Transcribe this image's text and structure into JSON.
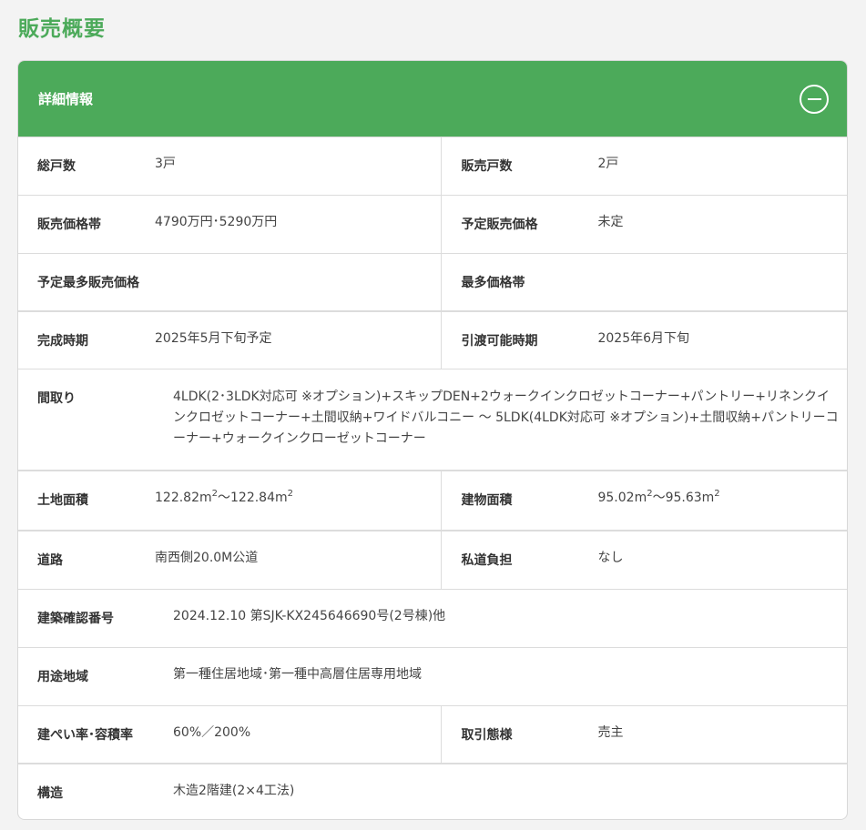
{
  "page_title": "販売概要",
  "section": {
    "title": "詳細情報",
    "collapse_icon": "minus-circle-icon"
  },
  "rows": {
    "total_units": {
      "label": "総戸数",
      "value": "3戸"
    },
    "units_for_sale": {
      "label": "販売戸数",
      "value": "2戸"
    },
    "price_range": {
      "label": "販売価格帯",
      "value": "4790万円･5290万円"
    },
    "planned_price": {
      "label": "予定販売価格",
      "value": "未定"
    },
    "planned_most_common_price": {
      "label": "予定最多販売価格",
      "value": ""
    },
    "most_common_price_band": {
      "label": "最多価格帯",
      "value": ""
    },
    "completion": {
      "label": "完成時期",
      "value": "2025年5月下旬予定"
    },
    "handover": {
      "label": "引渡可能時期",
      "value": "2025年6月下旬"
    },
    "layout": {
      "label": "間取り",
      "value": "4LDK(2･3LDK対応可 ※オプション)+スキップDEN+2ウォークインクロゼットコーナー+パントリー+リネンクインクロゼットコーナー+土間収納+ワイドバルコニー 〜 5LDK(4LDK対応可 ※オプション)+土間収納+パントリーコーナー+ウォークインクローゼットコーナー"
    },
    "land_area": {
      "label": "土地面積",
      "min": "122.82m",
      "sep": "〜",
      "max": "122.84m",
      "unit_exp": "2"
    },
    "building_area": {
      "label": "建物面積",
      "min": "95.02m",
      "sep": "〜",
      "max": "95.63m",
      "unit_exp": "2"
    },
    "road": {
      "label": "道路",
      "value": "南西側20.0M公道"
    },
    "private_road_burden": {
      "label": "私道負担",
      "value": "なし"
    },
    "building_confirmation": {
      "label": "建築確認番号",
      "value": "2024.12.10 第SJK-KX245646690号(2号棟)他"
    },
    "zoning": {
      "label": "用途地域",
      "value": "第一種住居地域･第一種中高層住居専用地域"
    },
    "coverage_ratio": {
      "label": "建ぺい率･容積率",
      "value": "60%／200%"
    },
    "transaction_type": {
      "label": "取引態様",
      "value": "売主"
    },
    "structure": {
      "label": "構造",
      "value": "木造2階建(2×4工法)"
    }
  },
  "colors": {
    "accent": "#4caa5a",
    "border": "#dcdcdc",
    "text": "#333333"
  }
}
